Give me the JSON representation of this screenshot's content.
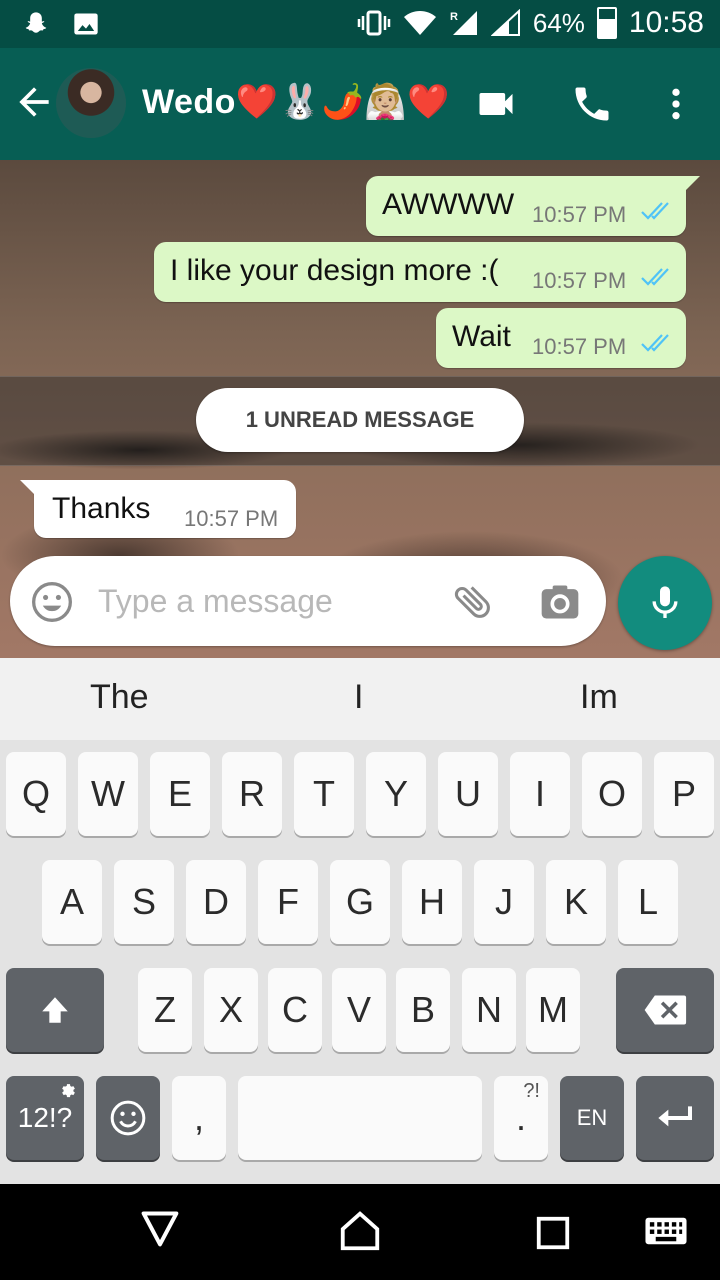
{
  "status_bar": {
    "battery": "64%",
    "time": "10:58",
    "icons": [
      "snapchat-icon",
      "gallery-icon",
      "vibrate-icon",
      "wifi-icon",
      "signal-r-icon",
      "signal-icon",
      "battery-icon"
    ]
  },
  "header": {
    "contact_name": "Wedo❤️🐰🌶️👰🏼❤️",
    "icons": [
      "back-arrow-icon",
      "video-call-icon",
      "phone-icon",
      "more-vert-icon"
    ]
  },
  "messages": [
    {
      "direction": "outgoing",
      "text": "AWWWW",
      "time": "10:57 PM",
      "status": "read"
    },
    {
      "direction": "outgoing",
      "text": "I like your design more :(",
      "time": "10:57 PM",
      "status": "read"
    },
    {
      "direction": "outgoing",
      "text": "Wait",
      "time": "10:57 PM",
      "status": "read"
    },
    {
      "direction": "incoming",
      "text": "Thanks",
      "time": "10:57 PM"
    }
  ],
  "unread_banner": "1 UNREAD MESSAGE",
  "composer": {
    "placeholder": "Type a message",
    "value": ""
  },
  "suggestions": [
    "The",
    "I",
    "Im"
  ],
  "keyboard": {
    "row1": [
      "Q",
      "W",
      "E",
      "R",
      "T",
      "Y",
      "U",
      "I",
      "O",
      "P"
    ],
    "row2": [
      "A",
      "S",
      "D",
      "F",
      "G",
      "H",
      "J",
      "K",
      "L"
    ],
    "row3": [
      "Z",
      "X",
      "C",
      "V",
      "B",
      "N",
      "M"
    ],
    "symbols_key": "12!?",
    "comma": ",",
    "period": ".",
    "period_sub": "?!",
    "language": "EN"
  },
  "colors": {
    "status_bar": "#054d44",
    "header": "#075e54",
    "outgoing_bubble": "#dcf8c6",
    "incoming_bubble": "#ffffff",
    "read_ticks": "#4fc3f7",
    "mic_button": "#128c7e"
  }
}
